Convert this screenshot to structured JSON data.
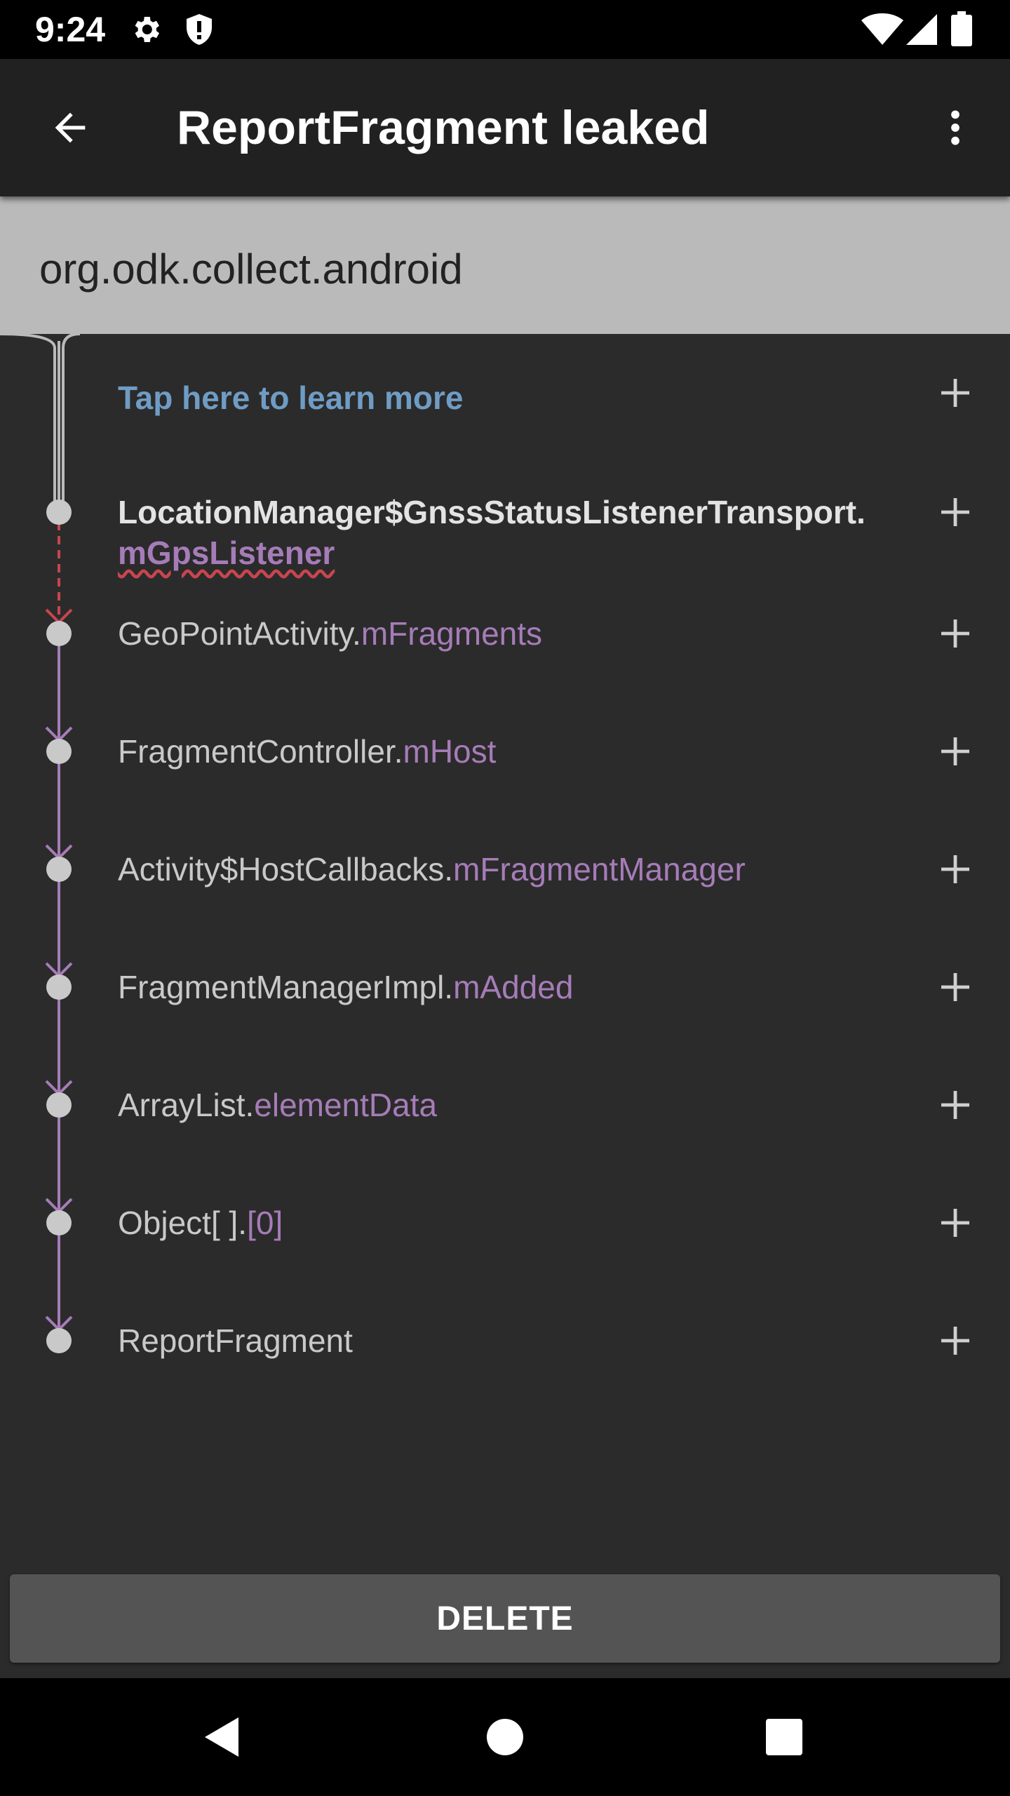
{
  "status_bar": {
    "time": "9:24",
    "left_icons": [
      "gear-icon",
      "shield-icon"
    ],
    "right_icons": [
      "wifi-icon",
      "cell-signal-icon",
      "battery-icon"
    ]
  },
  "app_bar": {
    "title": "ReportFragment leaked",
    "back_icon": "arrow-back-icon",
    "menu_icon": "more-vert-icon"
  },
  "package": {
    "name": "org.odk.collect.android"
  },
  "trace": {
    "learn_more": "Tap here to learn more",
    "expand_icon": "plus-icon",
    "rows": [
      {
        "owner": "LocationManager$GnssStatusListenerTransport.",
        "ref": "mGpsListener",
        "suspect": true
      },
      {
        "owner": "GeoPointActivity.",
        "ref": "mFragments",
        "suspect": false
      },
      {
        "owner": "FragmentController.",
        "ref": "mHost",
        "suspect": false
      },
      {
        "owner": "Activity$HostCallbacks.",
        "ref": "mFragmentManager",
        "suspect": false
      },
      {
        "owner": "FragmentManagerImpl.",
        "ref": "mAdded",
        "suspect": false
      },
      {
        "owner": "ArrayList.",
        "ref": "elementData",
        "suspect": false
      },
      {
        "owner": "Object[ ].",
        "ref": "[0]",
        "suspect": false
      },
      {
        "owner": "ReportFragment",
        "ref": "",
        "suspect": false
      }
    ]
  },
  "actions": {
    "delete_label": "DELETE"
  },
  "colors": {
    "reference": "#a67cb8",
    "suspect_line": "#c8454f",
    "link": "#6f9cc4",
    "trace_background": "#2b2b2b",
    "banner_background": "#bababa"
  },
  "nav_bar": {
    "icons": [
      "back-triangle-icon",
      "home-circle-icon",
      "recents-square-icon"
    ]
  }
}
